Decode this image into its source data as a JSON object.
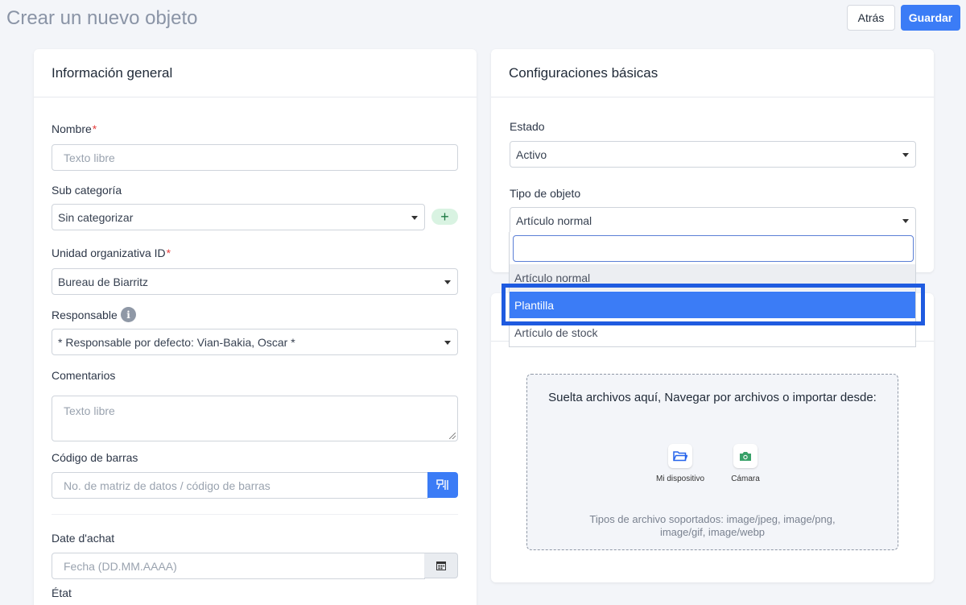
{
  "header": {
    "title": "Crear un nuevo objeto",
    "back_label": "Atrás",
    "save_label": "Guardar"
  },
  "general": {
    "title": "Información general",
    "name_label": "Nombre",
    "name_required": "*",
    "name_placeholder": "Texto libre",
    "subcat_label": "Sub categoría",
    "subcat_value": "Sin categorizar",
    "subcat_add": "+",
    "unit_label": "Unidad organizativa ID",
    "unit_required": "*",
    "unit_value": "Bureau de Biarritz",
    "resp_label": "Responsable",
    "resp_info": "i",
    "resp_value": "* Responsable por defecto: Vian-Bakia, Oscar *",
    "comments_label": "Comentarios",
    "comments_placeholder": "Texto libre",
    "barcode_label": "Código de barras",
    "barcode_placeholder": "No. de matriz de datos / código de barras",
    "purchase_label": "Date d'achat",
    "purchase_placeholder": "Fecha (DD.MM.AAAA)",
    "state_label": "État"
  },
  "basic": {
    "title": "Configuraciones básicas",
    "status_label": "Estado",
    "status_value": "Activo",
    "type_label": "Tipo de objeto",
    "type_value": "Artículo normal",
    "type_options": [
      "Artículo normal",
      "Plantilla",
      "Artículo de stock"
    ]
  },
  "upload": {
    "title": "Suelta archivos aquí, Navegar por archivos o importar desde:",
    "device_label": "Mi dispositivo",
    "camera_label": "Cámara",
    "types_text": "Tipos de archivo soportados: image/jpeg, image/png, image/gif, image/webp"
  },
  "colors": {
    "accent": "#3b7cf6",
    "highlight": "#1f5be0",
    "required": "#e53e3e"
  }
}
